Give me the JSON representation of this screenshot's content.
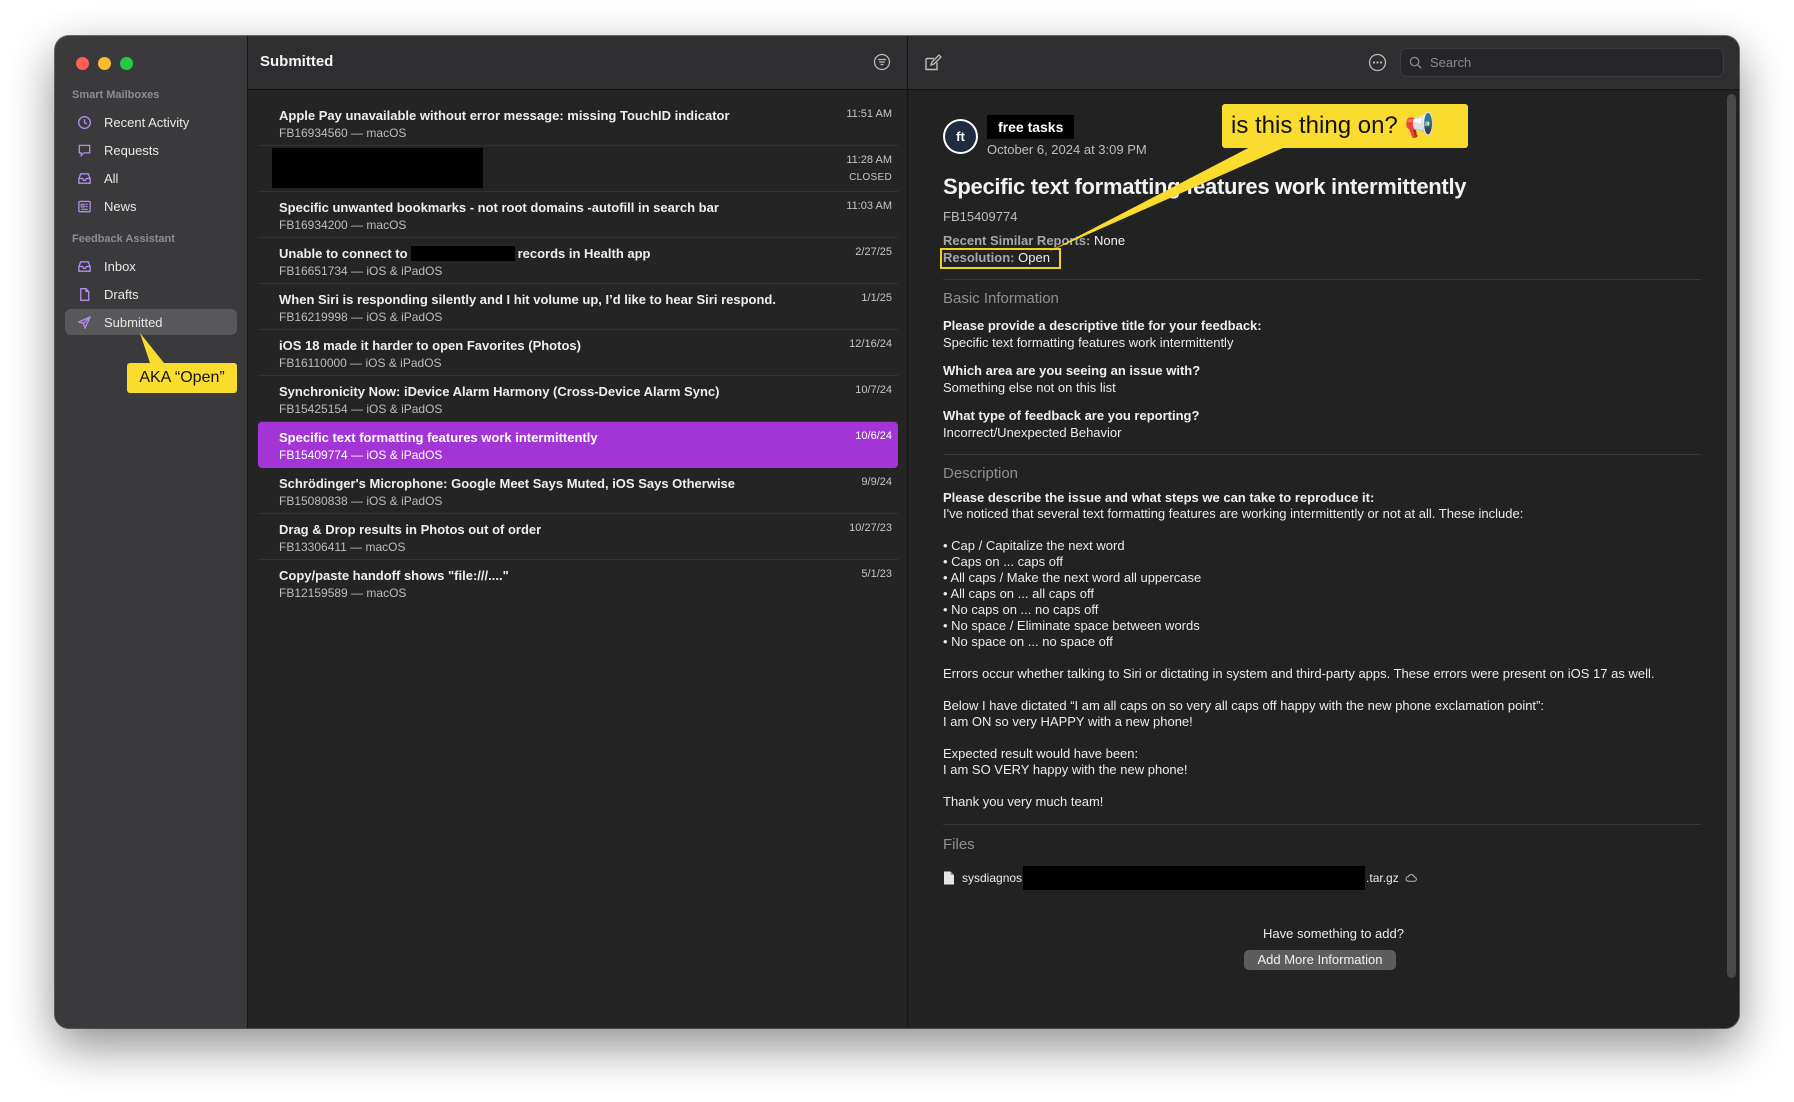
{
  "sidebar": {
    "smart_mailboxes_label": "Smart Mailboxes",
    "smart_mailboxes": [
      {
        "label": "Recent Activity",
        "icon": "clock-icon"
      },
      {
        "label": "Requests",
        "icon": "speech-bubble-icon"
      },
      {
        "label": "All",
        "icon": "tray-icon"
      },
      {
        "label": "News",
        "icon": "newspaper-icon"
      }
    ],
    "feedback_assistant_label": "Feedback Assistant",
    "feedback_assistant": [
      {
        "label": "Inbox",
        "icon": "tray-icon"
      },
      {
        "label": "Drafts",
        "icon": "document-icon"
      },
      {
        "label": "Submitted",
        "icon": "paper-plane-icon",
        "active": true
      }
    ]
  },
  "list": {
    "title": "Submitted",
    "rows": [
      {
        "title": "Apple Pay unavailable without error message: missing TouchID indicator",
        "sub": "FB16934560 — macOS",
        "date": "11:51 AM"
      },
      {
        "title": "",
        "sub": "",
        "date": "11:28 AM",
        "status": "CLOSED"
      },
      {
        "title": "Specific unwanted bookmarks - not root domains -autofill in search bar",
        "sub": "FB16934200 — macOS",
        "date": "11:03 AM"
      },
      {
        "title_a": "Unable to connect to",
        "title_b": "records in Health app",
        "sub": "FB16651734 — iOS & iPadOS",
        "date": "2/27/25"
      },
      {
        "title": "When Siri is responding silently and I hit volume up, I’d like to hear Siri respond.",
        "sub": "FB16219998 — iOS & iPadOS",
        "date": "1/1/25"
      },
      {
        "title": "iOS 18 made it harder to open Favorites (Photos)",
        "sub": "FB16110000 — iOS & iPadOS",
        "date": "12/16/24"
      },
      {
        "title": "Synchronicity Now: iDevice Alarm Harmony (Cross-Device Alarm Sync)",
        "sub": "FB15425154 — iOS & iPadOS",
        "date": "10/7/24"
      },
      {
        "title": "Specific text formatting features work intermittently",
        "sub": "FB15409774 — iOS & iPadOS",
        "date": "10/6/24",
        "selected": true
      },
      {
        "title": "Schrödinger's Microphone: Google Meet Says Muted, iOS Says Otherwise",
        "sub": "FB15080838 — iOS & iPadOS",
        "date": "9/9/24"
      },
      {
        "title": "Drag & Drop results in Photos out of order",
        "sub": "FB13306411 — macOS",
        "date": "10/27/23"
      },
      {
        "title": "Copy/paste handoff shows \"file:///....\"",
        "sub": "FB12159589 — macOS",
        "date": "5/1/23"
      }
    ]
  },
  "detail": {
    "search_placeholder": "Search",
    "avatar_initials": "ft",
    "author": "free tasks",
    "created": "October 6, 2024 at 3:09 PM",
    "title": "Specific text formatting features work intermittently",
    "id": "FB15409774",
    "similar_label": "Recent Similar Reports:",
    "similar_value": "None",
    "resolution_label": "Resolution:",
    "resolution_value": "Open",
    "basic_info_title": "Basic Information",
    "q1": "Please provide a descriptive title for your feedback:",
    "a1": "Specific text formatting features work intermittently",
    "q2": "Which area are you seeing an issue with?",
    "a2": "Something else not on this list",
    "q3": "What type of feedback are you reporting?",
    "a3": "Incorrect/Unexpected Behavior",
    "description_title": "Description",
    "q4": "Please describe the issue and what steps we can take to reproduce it:",
    "description_lines": [
      "I've noticed that several text formatting features are working intermittently or not at all. These include:",
      "",
      "• Cap / Capitalize the next word",
      "• Caps on ... caps off",
      "• All caps / Make the next word all uppercase",
      "• All caps on ... all caps off",
      "• No caps on ... no caps off",
      "• No space / Eliminate space between words",
      "• No space on ... no space off",
      "",
      "Errors occur whether talking to Siri or dictating in system and third-party apps. These errors were present on iOS 17 as well.",
      "",
      "Below I have dictated “I am all caps on so very all caps off happy with the new phone exclamation point”:",
      "I am ON so very HAPPY with a new phone!",
      "",
      "Expected result would have been:",
      "I am SO VERY happy with the new phone!",
      "",
      "Thank you very much team!"
    ],
    "files_title": "Files",
    "file_prefix": "sysdiagnos",
    "file_suffix": ".tar.gz",
    "add_prompt": "Have something to add?",
    "add_button": "Add More Information"
  },
  "annotations": {
    "aka_open": "AKA “Open”",
    "is_this_on": "is this thing on? 📢",
    "callout_color": "#f9dc2e",
    "selection_color": "#a335d6"
  }
}
